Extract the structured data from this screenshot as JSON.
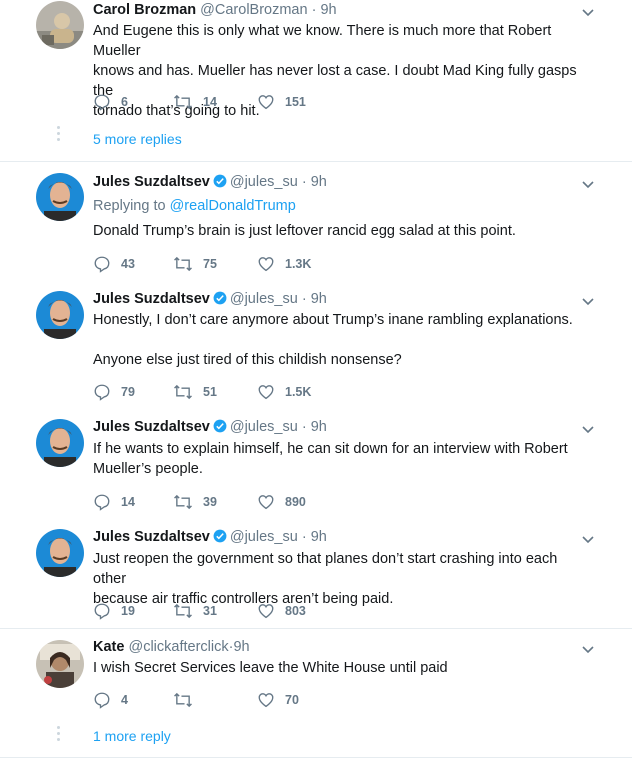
{
  "tweets": [
    {
      "name": "Carol Brozman",
      "handle": "@CarolBrozman",
      "dot": "·",
      "time": "9h",
      "verified": false,
      "reply_to_prefix": "",
      "reply_to_handle": "",
      "text": "And Eugene this is only what we know. There is much more that Robert Mueller\nknows and has. Mueller has never lost a case. I doubt Mad King fully gasps the\ntornado that’s going to hit.",
      "replies": "6",
      "retweets": "14",
      "likes": "151"
    },
    {
      "name": "Jules Suzdaltsev",
      "handle": "@jules_su",
      "dot": "·",
      "time": "9h",
      "verified": true,
      "reply_to_prefix": "Replying to ",
      "reply_to_handle": "@realDonaldTrump",
      "text": "Donald Trump’s brain is just leftover rancid egg salad at this point.",
      "replies": "43",
      "retweets": "75",
      "likes": "1.3K"
    },
    {
      "name": "Jules Suzdaltsev",
      "handle": "@jules_su",
      "dot": "·",
      "time": "9h",
      "verified": true,
      "text": "Honestly, I don’t care anymore about Trump’s inane rambling explanations.\n\nAnyone else just tired of this childish nonsense?",
      "replies": "79",
      "retweets": "51",
      "likes": "1.5K"
    },
    {
      "name": "Jules Suzdaltsev",
      "handle": "@jules_su",
      "dot": "·",
      "time": "9h",
      "verified": true,
      "text": "If he wants to explain himself, he can sit down for an interview with Robert\nMueller’s people.",
      "replies": "14",
      "retweets": "39",
      "likes": "890"
    },
    {
      "name": "Jules Suzdaltsev",
      "handle": "@jules_su",
      "dot": "·",
      "time": "9h",
      "verified": true,
      "text": "Just reopen the government so that planes don’t start crashing into each other\nbecause air traffic controllers aren’t being paid.",
      "replies": "19",
      "retweets": "31",
      "likes": "803"
    },
    {
      "name": "Kate",
      "handle": "@clickafterclick",
      "dot": "·",
      "time": "9h",
      "verified": false,
      "text": "I wish Secret Services leave the White House until paid",
      "replies": "4",
      "retweets": "",
      "likes": "70"
    }
  ],
  "more_replies_1": "5 more replies",
  "more_replies_2": "1 more reply",
  "colors": {
    "accent": "#1da1f2",
    "muted": "#657786",
    "border": "#e6ecf0",
    "text": "#14171a"
  },
  "icons": [
    "reply-icon",
    "retweet-icon",
    "like-icon",
    "chevron-down-icon",
    "verified-badge-icon"
  ]
}
